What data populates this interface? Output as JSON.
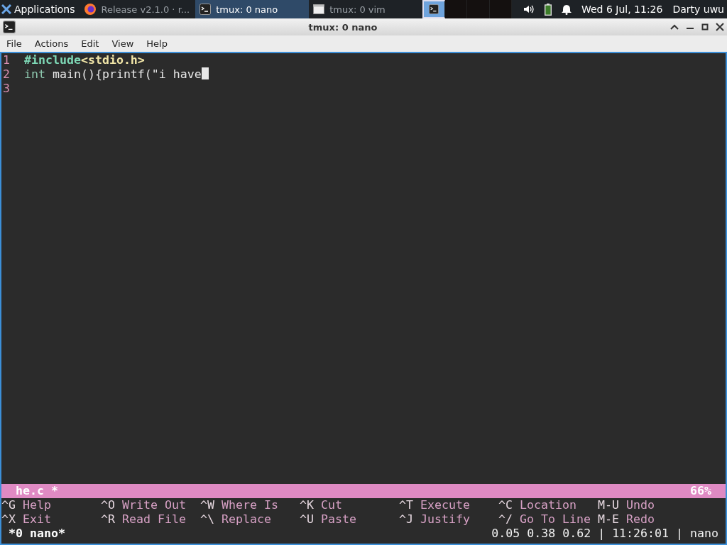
{
  "taskbar": {
    "apps_label": "Applications",
    "tasks": [
      {
        "kind": "browser",
        "label": "Release v2.1.0 · r...",
        "selected": false
      },
      {
        "kind": "terminal",
        "label": "tmux: 0 nano",
        "selected": true
      },
      {
        "kind": "window",
        "label": "tmux: 0 vim",
        "selected": false
      }
    ],
    "workspaces": [
      {
        "selected": true
      },
      {
        "selected": false
      },
      {
        "selected": false
      },
      {
        "selected": false
      }
    ],
    "clock": "Wed  6 Jul, 11:26",
    "user": "Darty uwu"
  },
  "window": {
    "title": "tmux: 0 nano"
  },
  "menu": [
    "File",
    "Actions",
    "Edit",
    "View",
    "Help"
  ],
  "editor": {
    "lines": [
      {
        "number": "1",
        "cursor": false,
        "tokens": [
          {
            "kind": "preprocessor",
            "text": "#include"
          },
          {
            "kind": "header",
            "text": "<stdio.h>"
          }
        ]
      },
      {
        "number": "2",
        "cursor": true,
        "tokens": [
          {
            "kind": "type",
            "text": "int"
          },
          {
            "kind": "plain",
            "text": " main(){printf(\"i have"
          }
        ]
      },
      {
        "number": "3",
        "cursor": false
      }
    ],
    "status": {
      "filename": "he.c *",
      "percent": "66%"
    },
    "shortcuts": [
      [
        {
          "key": "^G",
          "label": "Help"
        },
        {
          "key": "^O",
          "label": "Write Out"
        },
        {
          "key": "^W",
          "label": "Where Is"
        },
        {
          "key": "^K",
          "label": "Cut"
        },
        {
          "key": "^T",
          "label": "Execute"
        },
        {
          "key": "^C",
          "label": "Location"
        },
        {
          "key": "M-U",
          "label": "Undo"
        }
      ],
      [
        {
          "key": "^X",
          "label": "Exit"
        },
        {
          "key": "^R",
          "label": "Read File"
        },
        {
          "key": "^\\",
          "label": "Replace"
        },
        {
          "key": "^U",
          "label": "Paste"
        },
        {
          "key": "^J",
          "label": "Justify"
        },
        {
          "key": "^/",
          "label": "Go To Line"
        },
        {
          "key": "M-E",
          "label": "Redo"
        }
      ]
    ]
  },
  "tmux": {
    "window": "*0 nano*",
    "right": "0.05 0.38 0.62 | 11:26:01 | nano"
  }
}
